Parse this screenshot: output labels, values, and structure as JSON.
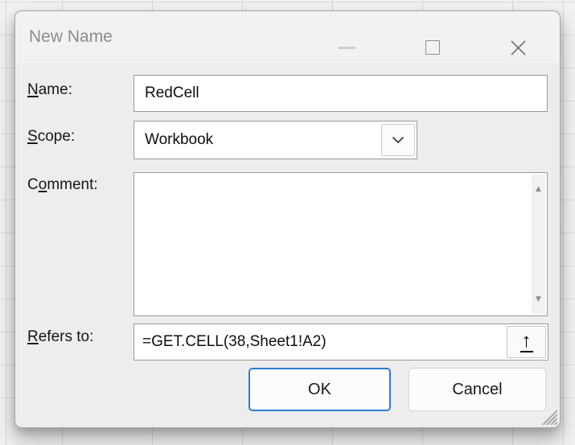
{
  "window": {
    "title": "New Name"
  },
  "fields": {
    "name": {
      "label_pre": "",
      "label_accel": "N",
      "label_post": "ame:",
      "value": "RedCell"
    },
    "scope": {
      "label_pre": "",
      "label_accel": "S",
      "label_post": "cope:",
      "value": "Workbook"
    },
    "comment": {
      "label_pre": "C",
      "label_accel": "o",
      "label_post": "mment:",
      "value": ""
    },
    "refers_to": {
      "label_pre": "",
      "label_accel": "R",
      "label_post": "efers to:",
      "value": "=GET.CELL(38,Sheet1!A2)"
    }
  },
  "buttons": {
    "ok": "OK",
    "cancel": "Cancel"
  },
  "icons": {
    "minimize": "minimize-dash-icon",
    "maximize": "maximize-square-icon",
    "close": "close-x-icon",
    "scope_dropdown": "chevron-down-icon",
    "collapse_dialog_glyph": "↑",
    "scroll_up_glyph": "▲",
    "scroll_down_glyph": "▼"
  },
  "colors": {
    "ok_focus_border": "#2b7cd3",
    "dialog_bg": "#eeedee",
    "title_text": "#8c8c8c"
  }
}
